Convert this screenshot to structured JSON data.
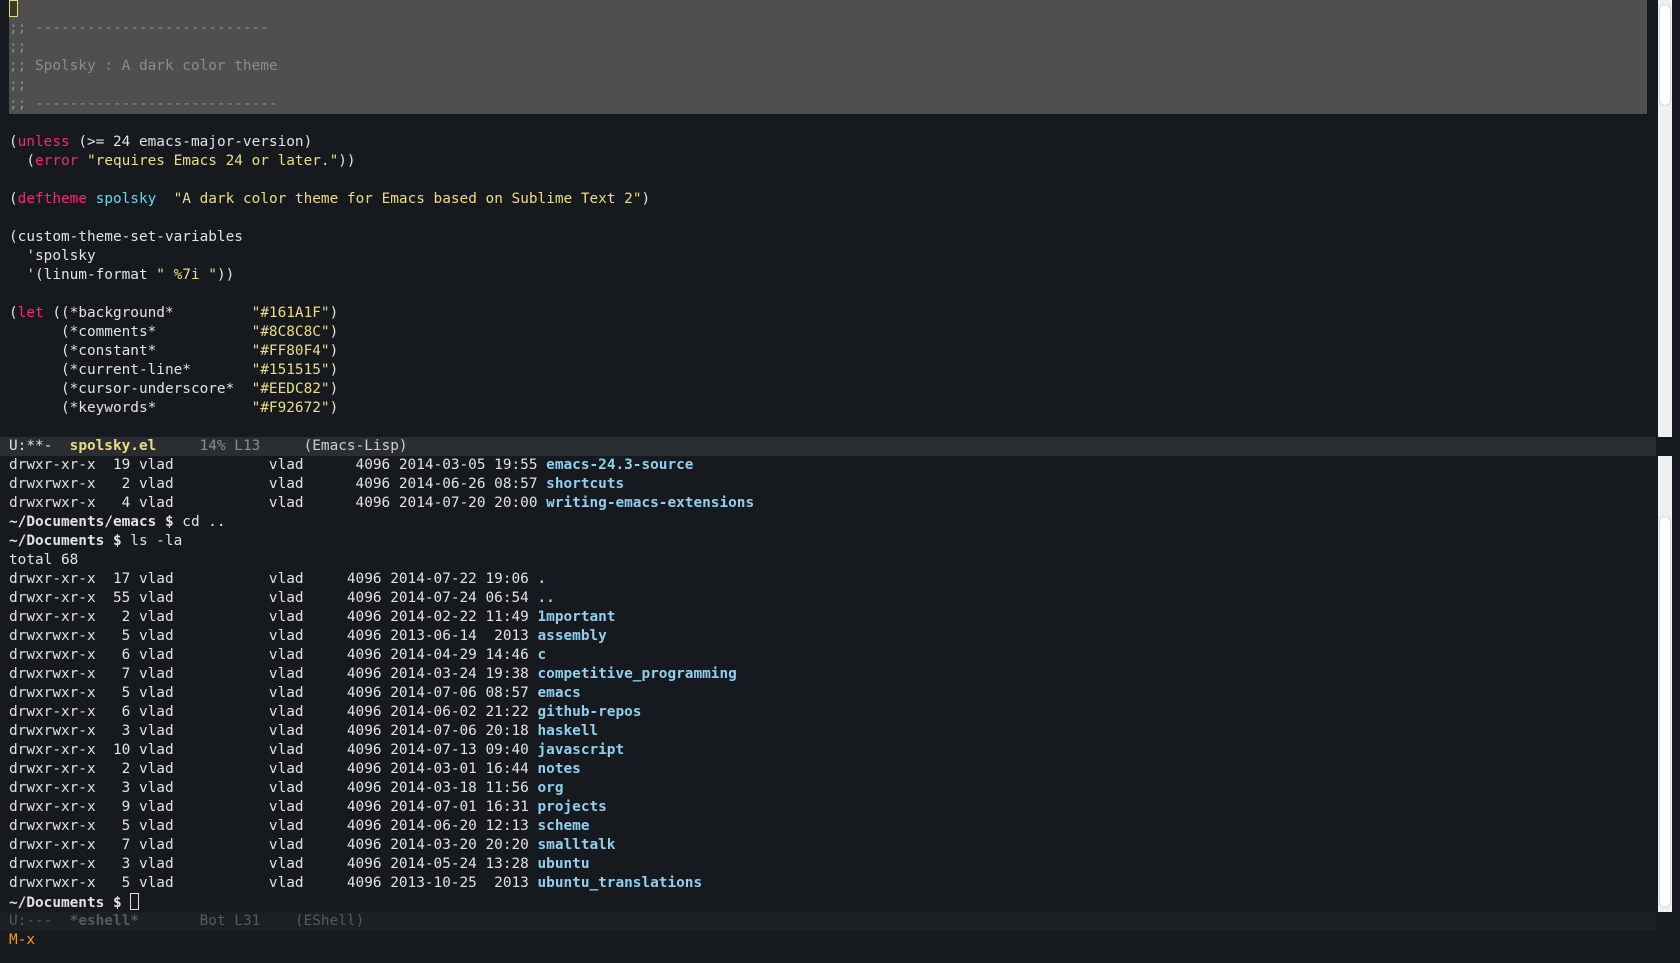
{
  "editor": {
    "header": [
      ";; ---------------------------",
      ";;",
      ";; Spolsky : A dark color theme",
      ";;",
      ";; ----------------------------"
    ],
    "code": {
      "unless": "unless",
      "unless_rest": " (>= 24 emacs-major-version)",
      "error": "error",
      "error_str": "\"requires Emacs 24 or later.\"",
      "deftheme": "deftheme",
      "theme_name": "spolsky",
      "theme_doc": "\"A dark color theme for Emacs based on Sublime Text 2\"",
      "custom_fn": "(custom-theme-set-variables",
      "custom_arg": "  'spolsky",
      "linum_pre": "  '(linum-format ",
      "linum_str": "\" %7i \"",
      "linum_post": "))",
      "let": "let",
      "vars": [
        {
          "name": "(*background*         ",
          "value": "\"#161A1F\""
        },
        {
          "name": "(*comments*           ",
          "value": "\"#8C8C8C\""
        },
        {
          "name": "(*constant*           ",
          "value": "\"#FF80F4\""
        },
        {
          "name": "(*current-line*       ",
          "value": "\"#151515\""
        },
        {
          "name": "(*cursor-underscore*  ",
          "value": "\"#EEDC82\""
        },
        {
          "name": "(*keywords*           ",
          "value": "\"#F92672\""
        }
      ]
    }
  },
  "modeline_top": {
    "status": "U:**-",
    "buffer": "spolsky.el",
    "position": "14% L13",
    "mode": "(Emacs-Lisp)"
  },
  "shell": {
    "top_listing": [
      {
        "meta": "drwxr-xr-x  19 vlad           vlad      4096 2014-03-05 19:55 ",
        "name": "emacs-24.3-source"
      },
      {
        "meta": "drwxrwxr-x   2 vlad           vlad      4096 2014-06-26 08:57 ",
        "name": "shortcuts"
      },
      {
        "meta": "drwxrwxr-x   4 vlad           vlad      4096 2014-07-20 20:00 ",
        "name": "writing-emacs-extensions"
      }
    ],
    "prompt1": "~/Documents/emacs $ ",
    "cmd1": "cd ..",
    "prompt2": "~/Documents $ ",
    "cmd2": "ls -la",
    "total": "total 68",
    "listing": [
      {
        "meta": "drwxr-xr-x  17 vlad           vlad     4096 2014-07-22 19:06 ",
        "name": "."
      },
      {
        "meta": "drwxr-xr-x  55 vlad           vlad     4096 2014-07-24 06:54 ",
        "name": ".."
      },
      {
        "meta": "drwxr-xr-x   2 vlad           vlad     4096 2014-02-22 11:49 ",
        "name": "1mportant"
      },
      {
        "meta": "drwxrwxr-x   5 vlad           vlad     4096 2013-06-14  2013 ",
        "name": "assembly"
      },
      {
        "meta": "drwxrwxr-x   6 vlad           vlad     4096 2014-04-29 14:46 ",
        "name": "c"
      },
      {
        "meta": "drwxrwxr-x   7 vlad           vlad     4096 2014-03-24 19:38 ",
        "name": "competitive_programming"
      },
      {
        "meta": "drwxrwxr-x   5 vlad           vlad     4096 2014-07-06 08:57 ",
        "name": "emacs"
      },
      {
        "meta": "drwxr-xr-x   6 vlad           vlad     4096 2014-06-02 21:22 ",
        "name": "github-repos"
      },
      {
        "meta": "drwxrwxr-x   3 vlad           vlad     4096 2014-07-06 20:18 ",
        "name": "haskell"
      },
      {
        "meta": "drwxr-xr-x  10 vlad           vlad     4096 2014-07-13 09:40 ",
        "name": "javascript"
      },
      {
        "meta": "drwxr-xr-x   2 vlad           vlad     4096 2014-03-01 16:44 ",
        "name": "notes"
      },
      {
        "meta": "drwxr-xr-x   3 vlad           vlad     4096 2014-03-18 11:56 ",
        "name": "org"
      },
      {
        "meta": "drwxr-xr-x   9 vlad           vlad     4096 2014-07-01 16:31 ",
        "name": "projects"
      },
      {
        "meta": "drwxrwxr-x   5 vlad           vlad     4096 2014-06-20 12:13 ",
        "name": "scheme"
      },
      {
        "meta": "drwxr-xr-x   7 vlad           vlad     4096 2014-03-20 20:20 ",
        "name": "smalltalk"
      },
      {
        "meta": "drwxrwxr-x   3 vlad           vlad     4096 2014-05-24 13:28 ",
        "name": "ubuntu"
      },
      {
        "meta": "drwxrwxr-x   5 vlad           vlad     4096 2013-10-25  2013 ",
        "name": "ubuntu_translations"
      }
    ],
    "prompt3": "~/Documents $ "
  },
  "modeline_bottom": {
    "status": "U:---",
    "buffer": "*eshell*",
    "position": "Bot L31",
    "mode": "(EShell)"
  },
  "minibuffer": "M-x",
  "colors": {
    "background": "#161A1F",
    "comments": "#8C8C8C",
    "keywords": "#F92672",
    "function": "#66D9EF",
    "string": "#EEDC82",
    "directory": "#90CFF0",
    "region": "#4F4F4F",
    "minibuffer_prompt": "#FF9900"
  }
}
